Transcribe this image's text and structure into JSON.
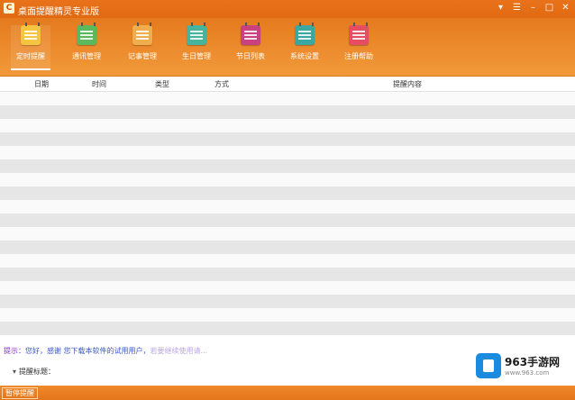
{
  "window": {
    "title": "桌面提醒精灵专业版",
    "app_icon": "C",
    "controls": [
      {
        "name": "skin-icon",
        "glyph": "▾"
      },
      {
        "name": "menu-icon",
        "glyph": "☰"
      },
      {
        "name": "minimize-icon",
        "glyph": "–"
      },
      {
        "name": "maximize-icon",
        "glyph": "□"
      },
      {
        "name": "close-icon",
        "glyph": "✕"
      }
    ]
  },
  "toolbar": {
    "items": [
      {
        "label": "定时提醒",
        "color": "#f5c542"
      },
      {
        "label": "通讯管理",
        "color": "#5cb85c"
      },
      {
        "label": "记事管理",
        "color": "#f0ad4e"
      },
      {
        "label": "生日管理",
        "color": "#47b39d"
      },
      {
        "label": "节日列表",
        "color": "#c9417e"
      },
      {
        "label": "系统设置",
        "color": "#3aa7a0"
      },
      {
        "label": "注册帮助",
        "color": "#e44d62"
      }
    ]
  },
  "table": {
    "columns": [
      "日期",
      "时间",
      "类型",
      "方式",
      "提醒内容"
    ],
    "rows": []
  },
  "tip": {
    "lead": "提示：",
    "text": "您好，感谢 您下载本软件的试用用户，",
    "dim": "若要继续使用请..."
  },
  "remind": {
    "label": "提醒标题："
  },
  "status": {
    "button_label": "暂停提醒"
  },
  "watermark": {
    "name": "963手游网",
    "url": "www.963.com"
  }
}
